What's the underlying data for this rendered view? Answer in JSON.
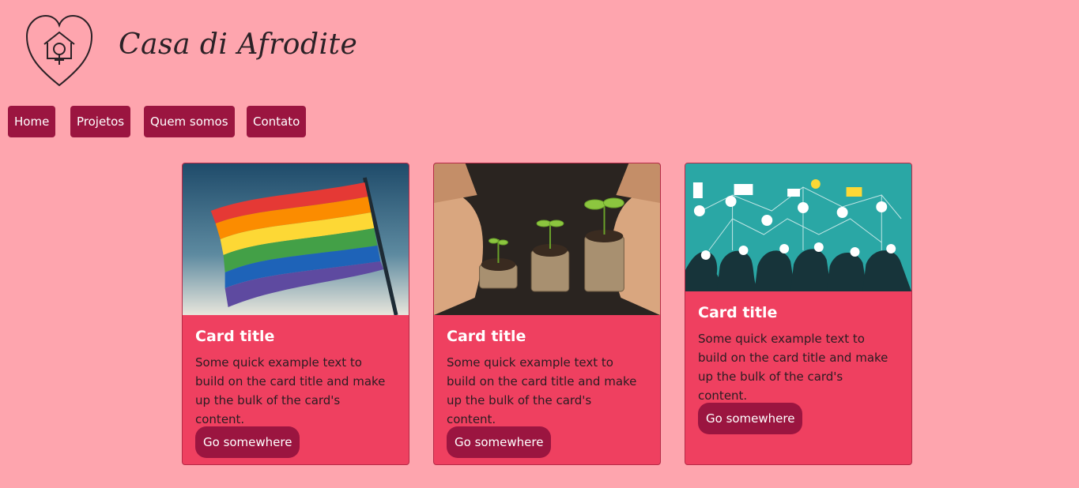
{
  "brand": {
    "title": "Casa di Afrodite",
    "logo_icon": "heart-house-venus-icon"
  },
  "nav": {
    "items": [
      {
        "label": "Home"
      },
      {
        "label": "Projetos"
      },
      {
        "label": "Quem somos"
      },
      {
        "label": "Contato"
      }
    ]
  },
  "cards": [
    {
      "image_icon": "rainbow-flag-photo",
      "title": "Card title",
      "text": "Some quick example text to build on the card title and make up the bulk of the card's content.",
      "button": "Go somewhere"
    },
    {
      "image_icon": "hands-coins-sprouts-photo",
      "title": "Card title",
      "text": "Some quick example text to build on the card title and make up the bulk of the card's content.",
      "button": "Go somewhere"
    },
    {
      "image_icon": "people-network-illustration",
      "title": "Card title",
      "text": "Some quick example text to build on the card title and make up the bulk of the card's content.",
      "button": "Go somewhere"
    }
  ],
  "colors": {
    "page_background": "#fea5ae",
    "card_background": "#ef4060",
    "button_background": "#9b1540",
    "button_text": "#ffffff"
  }
}
